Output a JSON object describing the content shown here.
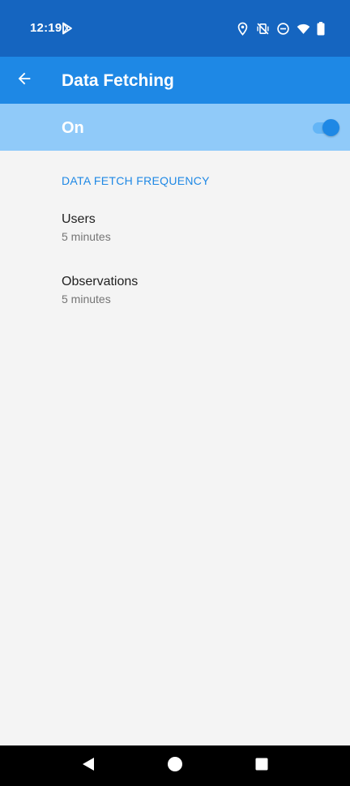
{
  "status_bar": {
    "time": "12:19",
    "icons": [
      "play-store-icon",
      "location-icon",
      "vibrate-off-icon",
      "do-not-disturb-icon",
      "wifi-icon",
      "battery-icon"
    ]
  },
  "app_bar": {
    "title": "Data Fetching",
    "back_icon": "arrow-back-icon"
  },
  "master_switch": {
    "label": "On",
    "checked": true
  },
  "section": {
    "title": "DATA FETCH FREQUENCY"
  },
  "preferences": [
    {
      "title": "Users",
      "summary": "5 minutes"
    },
    {
      "title": "Observations",
      "summary": "5 minutes"
    }
  ],
  "nav_bar": {
    "buttons": [
      "back-icon",
      "home-icon",
      "recents-icon"
    ]
  },
  "colors": {
    "status_bar": "#1565c0",
    "app_bar": "#1e88e5",
    "switch_bar": "#90caf9",
    "accent": "#1e88e5",
    "background": "#f4f4f4"
  }
}
